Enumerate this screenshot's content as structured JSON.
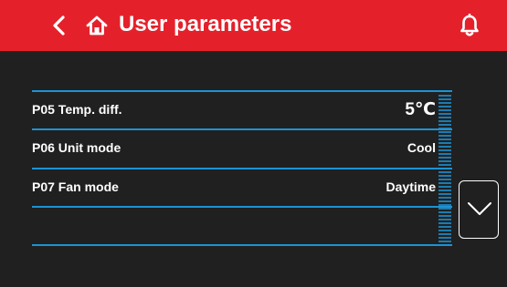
{
  "header": {
    "title": "User parameters",
    "back_icon": "chevron-left-icon",
    "home_icon": "home-icon",
    "notification_icon": "bell-icon",
    "background_color": "#e4212b"
  },
  "parameters": [
    {
      "label": "P05 Temp. diff.",
      "value": "5℃"
    },
    {
      "label": "P06 Unit mode",
      "value": "Cool"
    },
    {
      "label": "P07 Fan mode",
      "value": "Daytime"
    },
    {
      "label": "",
      "value": ""
    }
  ],
  "scroll": {
    "down_icon": "chevron-down-icon"
  },
  "colors": {
    "background": "#202020",
    "accent": "#1c93d4",
    "text": "#ffffff"
  }
}
